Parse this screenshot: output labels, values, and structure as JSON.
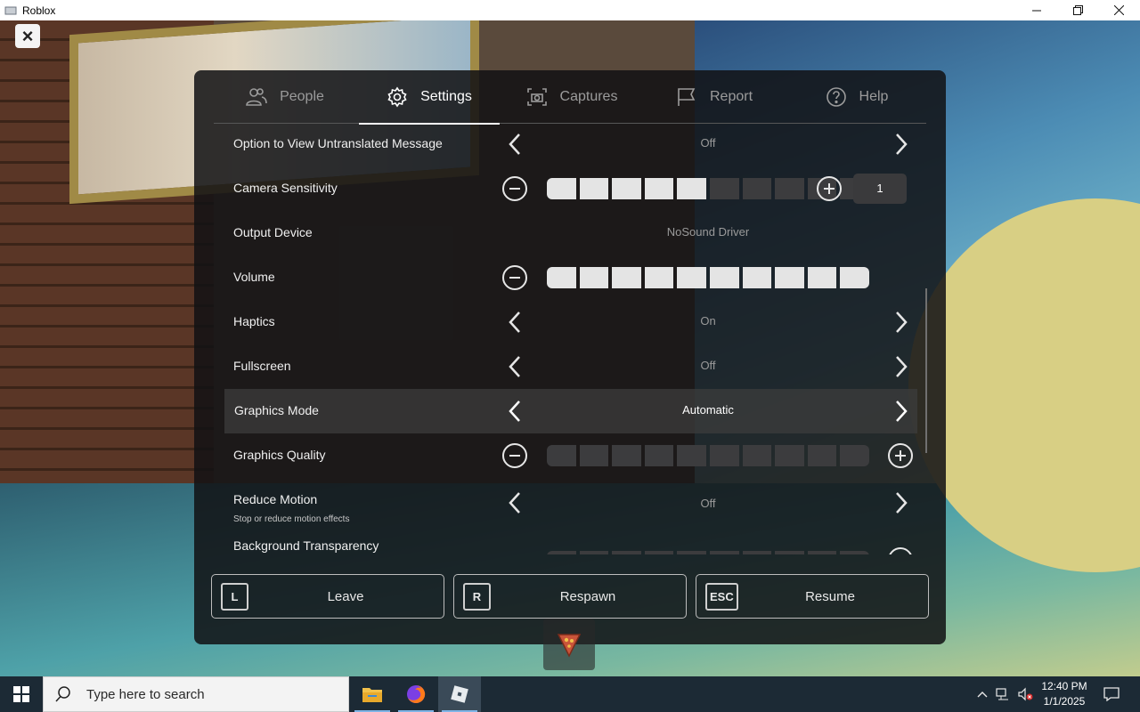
{
  "window": {
    "title": "Roblox",
    "controls": [
      "minimize",
      "restore",
      "close"
    ]
  },
  "overlay": {
    "close_icon": "×"
  },
  "tabs": [
    {
      "label": "People",
      "icon": "people-icon",
      "active": false
    },
    {
      "label": "Settings",
      "icon": "gear-icon",
      "active": true
    },
    {
      "label": "Captures",
      "icon": "camera-icon",
      "active": false
    },
    {
      "label": "Report",
      "icon": "flag-icon",
      "active": false
    },
    {
      "label": "Help",
      "icon": "help-icon",
      "active": false
    }
  ],
  "settings": {
    "untranslated": {
      "label": "Option to View Untranslated Message",
      "value": "Off"
    },
    "camera_sensitivity": {
      "label": "Camera Sensitivity",
      "value": "1",
      "level": 0.5
    },
    "output_device": {
      "label": "Output Device",
      "value": "NoSound Driver"
    },
    "volume": {
      "label": "Volume",
      "level": 1.0
    },
    "haptics": {
      "label": "Haptics",
      "value": "On"
    },
    "fullscreen": {
      "label": "Fullscreen",
      "value": "Off"
    },
    "graphics_mode": {
      "label": "Graphics Mode",
      "value": "Automatic"
    },
    "graphics_quality": {
      "label": "Graphics Quality",
      "level": 0.0
    },
    "reduce_motion": {
      "label": "Reduce Motion",
      "sublabel": "Stop or reduce motion effects",
      "value": "Off"
    },
    "background_transparency": {
      "label": "Background Transparency"
    }
  },
  "actions": [
    {
      "key": "L",
      "label": "Leave"
    },
    {
      "key": "R",
      "label": "Respawn"
    },
    {
      "key": "ESC",
      "label": "Resume"
    }
  ],
  "taskbar": {
    "search_placeholder": "Type here to search",
    "apps": [
      "file-explorer-icon",
      "firefox-icon",
      "roblox-icon"
    ],
    "time": "12:40 PM",
    "date": "1/1/2025"
  },
  "colors": {
    "panel_bg": "#121214",
    "accent_white": "#ffffff",
    "muted_text": "#9b9b9b",
    "taskbar_bg": "#1c2a35"
  }
}
